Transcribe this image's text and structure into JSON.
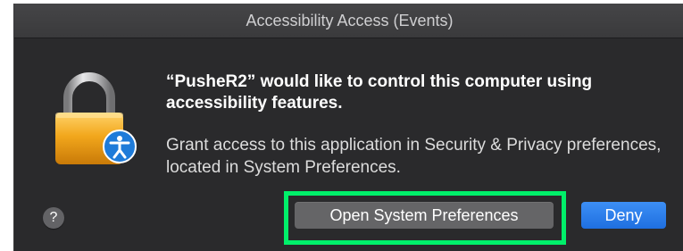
{
  "window": {
    "title": "Accessibility Access (Events)"
  },
  "message": {
    "title": "“PusheR2” would like to control this computer using accessibility features.",
    "body": "Grant access to this application in Security & Privacy preferences, located in System Preferences."
  },
  "buttons": {
    "help_label": "?",
    "open_prefs_label": "Open System Preferences",
    "deny_label": "Deny"
  },
  "icons": {
    "main": "lock-icon",
    "badge": "accessibility-icon"
  },
  "colors": {
    "dialog_bg": "#2a2a2c",
    "accent": "#1f6fe0",
    "highlight": "#00f06a",
    "lock_gold": "#f2a71c"
  }
}
